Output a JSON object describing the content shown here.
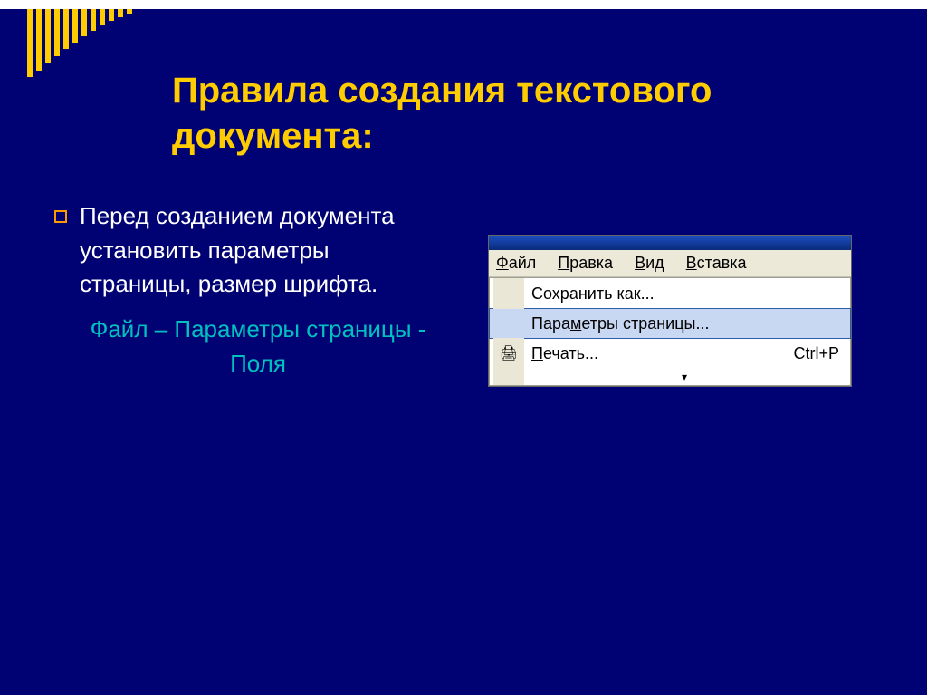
{
  "title_line1": "Правила создания текстового",
  "title_line2": "документа:",
  "bullet_text": "Перед созданием документа установить параметры страницы, размер шрифта.",
  "sub_text": "Файл – Параметры страницы - Поля",
  "menu": {
    "items": [
      "Файл",
      "Правка",
      "Вид",
      "Вставка"
    ],
    "dropdown": {
      "save_as": "Сохранить как...",
      "page_setup": "Параметры страницы...",
      "print": "Печать...",
      "print_shortcut": "Ctrl+P"
    }
  },
  "decor_bars": [
    75,
    68,
    60,
    52,
    44,
    37,
    30,
    24,
    18,
    13,
    9,
    6
  ]
}
